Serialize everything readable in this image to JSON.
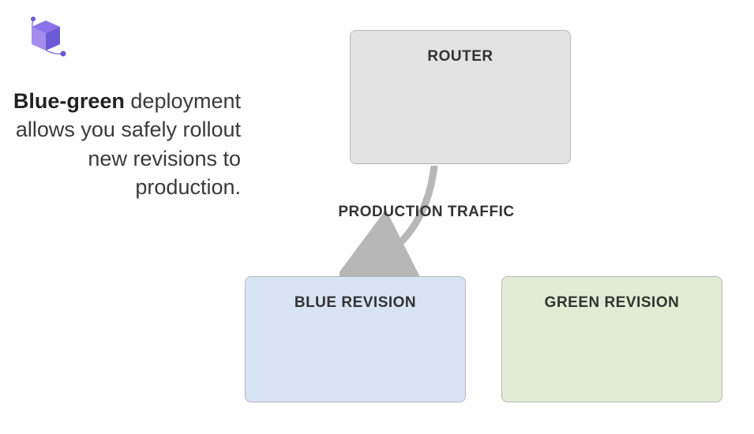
{
  "description": {
    "bold": "Blue-green",
    "rest": " deployment allows you safely rollout new revisions to production."
  },
  "boxes": {
    "router": "ROUTER",
    "blue": "BLUE REVISION",
    "green": "GREEN REVISION"
  },
  "arrow_label": "PRODUCTION TRAFFIC",
  "icon": "container-apps-icon",
  "colors": {
    "router_bg": "#e3e3e3",
    "blue_bg": "#d8e3f3",
    "green_bg": "#e0edd4",
    "arrow": "#b7b7b7"
  }
}
